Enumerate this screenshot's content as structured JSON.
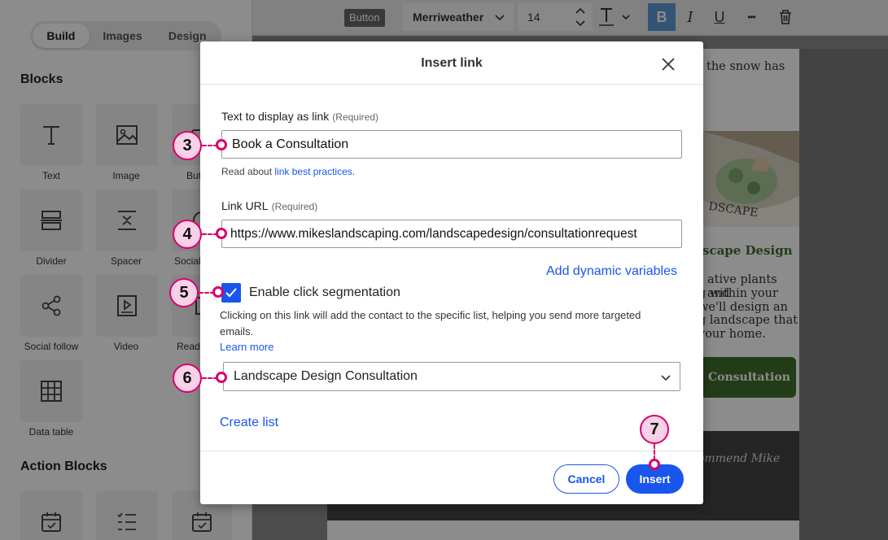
{
  "sidebar": {
    "tabs": [
      {
        "label": "Build",
        "active": true
      },
      {
        "label": "Images",
        "active": false
      },
      {
        "label": "Design",
        "active": false
      }
    ],
    "blocks_title": "Blocks",
    "blocks": [
      {
        "label": "Text",
        "icon": "text-icon"
      },
      {
        "label": "Image",
        "icon": "image-icon"
      },
      {
        "label": "Butt",
        "icon": "button-icon"
      },
      {
        "label": "Divider",
        "icon": "divider-icon"
      },
      {
        "label": "Spacer",
        "icon": "spacer-icon"
      },
      {
        "label": "Social",
        "icon": "social-icon"
      },
      {
        "label": "Social follow",
        "icon": "share-icon"
      },
      {
        "label": "Video",
        "icon": "video-icon"
      },
      {
        "label": "Read",
        "icon": "read-more-icon"
      },
      {
        "label": "Data table",
        "icon": "table-icon"
      }
    ],
    "action_title": "Action Blocks"
  },
  "toolbar": {
    "badge": "Button",
    "font": "Merriweather",
    "size": "14",
    "bold_label": "B",
    "italic_label": "I",
    "underline_label": "U",
    "more_label": "•••"
  },
  "email": {
    "intro_fragment": "the snow has",
    "heading_fragment": "scape Design",
    "body_lines": [
      "ative plants and",
      "g within your",
      "we'll design an",
      "g landscape that",
      "your home."
    ],
    "button_fragment": "Consultation",
    "quote_fragment": "ommend Mike",
    "photo_text": "DSCAPE"
  },
  "modal": {
    "title": "Insert link",
    "text_label": "Text to display as link",
    "required": "(Required)",
    "text_value": "Book a Consultation",
    "help_prefix": "Read about ",
    "help_link": "link best practices",
    "help_suffix": ".",
    "url_label": "Link URL",
    "url_value": "https://www.mikeslandscaping.com/landscapedesign/consultationrequest",
    "dynamic_link": "Add dynamic variables",
    "checkbox_label": "Enable click segmentation",
    "checkbox_checked": true,
    "description": "Clicking on this link will add the contact to the specific list, helping you send more targeted emails.",
    "learn_more": "Learn more",
    "list_value": "Landscape Design Consultation",
    "create_list": "Create list",
    "cancel": "Cancel",
    "insert": "Insert"
  },
  "callouts": [
    "3",
    "4",
    "5",
    "6",
    "7"
  ],
  "colors": {
    "primary": "#1856ed",
    "callout_border": "#d9006c",
    "callout_fill": "#f9d1e6",
    "email_green": "#3e6e2c"
  }
}
